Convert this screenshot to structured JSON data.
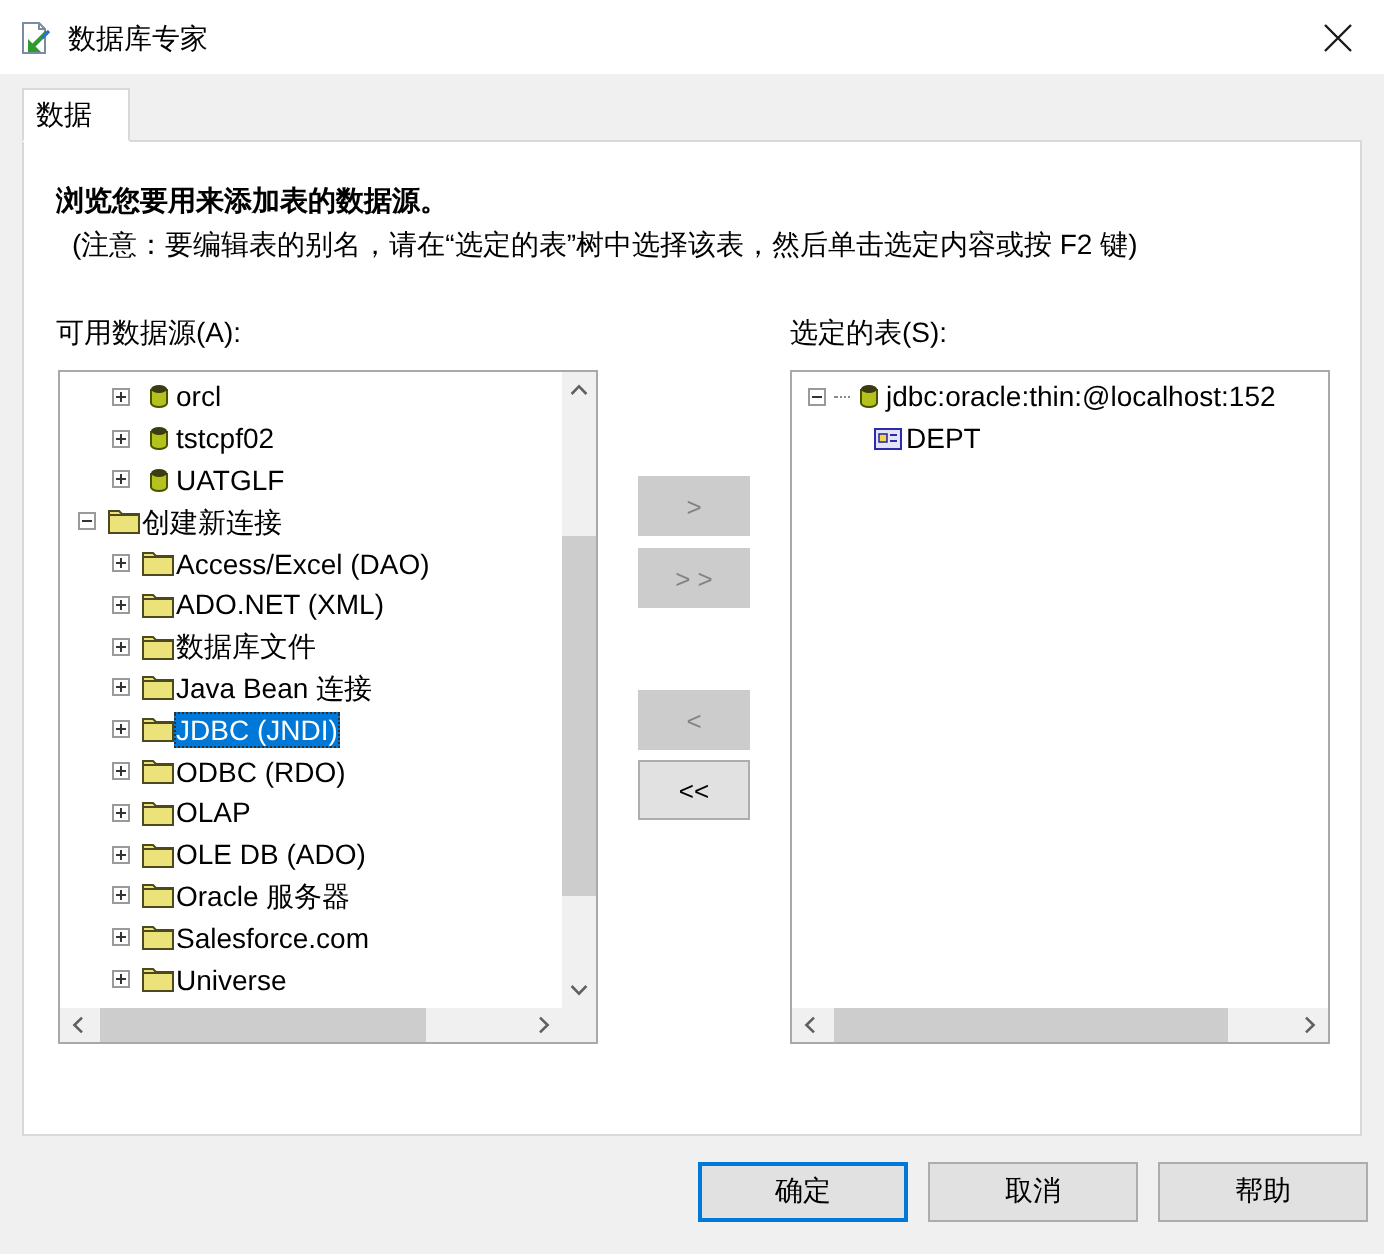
{
  "window": {
    "title": "数据库专家"
  },
  "tabs": [
    {
      "label": "数据",
      "selected": true
    }
  ],
  "instructions": {
    "heading": "浏览您要用来添加表的数据源。",
    "note": "(注意：要编辑表的别名，请在“选定的表”树中选择该表，然后单击选定内容或按 F2 键)"
  },
  "available_sources": {
    "label": "可用数据源(A):",
    "items": [
      {
        "children": [
          {
            "label": "orcl",
            "kind": "database",
            "expanded": false,
            "selected": false
          },
          {
            "label": "tstcpf02",
            "kind": "database",
            "expanded": false,
            "selected": false
          },
          {
            "label": "UATGLF",
            "kind": "database",
            "expanded": false,
            "selected": false
          }
        ]
      },
      {
        "label": "创建新连接",
        "kind": "folder",
        "expanded": true,
        "selected": false,
        "children": [
          {
            "label": "Access/Excel (DAO)",
            "kind": "folder",
            "expanded": false,
            "selected": false
          },
          {
            "label": "ADO.NET (XML)",
            "kind": "folder",
            "expanded": false,
            "selected": false
          },
          {
            "label": "数据库文件",
            "kind": "folder",
            "expanded": false,
            "selected": false
          },
          {
            "label": "Java Bean 连接",
            "kind": "folder",
            "expanded": false,
            "selected": false
          },
          {
            "label": "JDBC (JNDI)",
            "kind": "folder",
            "expanded": false,
            "selected": true
          },
          {
            "label": "ODBC (RDO)",
            "kind": "folder",
            "expanded": false,
            "selected": false
          },
          {
            "label": "OLAP",
            "kind": "folder",
            "expanded": false,
            "selected": false
          },
          {
            "label": "OLE DB (ADO)",
            "kind": "folder",
            "expanded": false,
            "selected": false
          },
          {
            "label": "Oracle 服务器",
            "kind": "folder",
            "expanded": false,
            "selected": false
          },
          {
            "label": "Salesforce.com",
            "kind": "folder",
            "expanded": false,
            "selected": false
          },
          {
            "label": "Universe",
            "kind": "folder",
            "expanded": false,
            "selected": false
          }
        ]
      }
    ]
  },
  "transfer_buttons": [
    {
      "label": ">",
      "disabled": true
    },
    {
      "label": "> >",
      "disabled": true
    },
    {
      "label": "<",
      "disabled": true
    },
    {
      "label": "<<",
      "disabled": false
    }
  ],
  "selected_tables": {
    "label": "选定的表(S):",
    "items": [
      {
        "label": "jdbc:oracle:thin:@localhost:152",
        "kind": "database",
        "expanded": true,
        "selected": false,
        "children": [
          {
            "label": "DEPT",
            "kind": "table",
            "selected": false
          }
        ]
      }
    ]
  },
  "buttons": [
    {
      "label": "确定",
      "default": true
    },
    {
      "label": "取消",
      "default": false
    },
    {
      "label": "帮助",
      "default": false
    }
  ]
}
